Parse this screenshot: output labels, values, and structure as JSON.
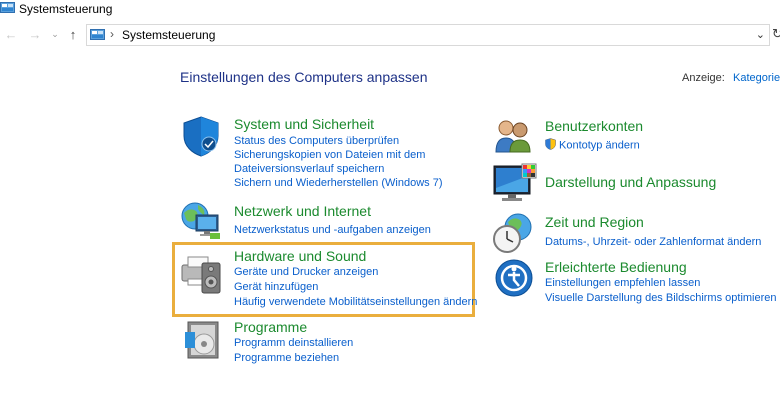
{
  "window": {
    "title": "Systemsteuerung"
  },
  "address": {
    "path": "Systemsteuerung"
  },
  "header": {
    "title": "Einstellungen des Computers anpassen",
    "view_label": "Anzeige:",
    "view_value": "Kategorie"
  },
  "categories": {
    "system": {
      "title": "System und Sicherheit",
      "links": [
        "Status des Computers überprüfen",
        "Sicherungskopien von Dateien mit dem",
        "Dateiversionsverlauf speichern",
        "Sichern und Wiederherstellen (Windows 7)"
      ]
    },
    "network": {
      "title": "Netzwerk und Internet",
      "links": [
        "Netzwerkstatus und -aufgaben anzeigen"
      ]
    },
    "hardware": {
      "title": "Hardware und Sound",
      "links": [
        "Geräte und Drucker anzeigen",
        "Gerät hinzufügen",
        "Häufig verwendete Mobilitätseinstellungen ändern"
      ]
    },
    "programs": {
      "title": "Programme",
      "links": [
        "Programm deinstallieren",
        "Programme beziehen"
      ]
    },
    "users": {
      "title": "Benutzerkonten",
      "links": [
        "Kontotyp ändern"
      ]
    },
    "appearance": {
      "title": "Darstellung und Anpassung",
      "links": []
    },
    "clock": {
      "title": "Zeit und Region",
      "links": [
        "Datums-, Uhrzeit- oder Zahlenformat ändern"
      ]
    },
    "access": {
      "title": "Erleichterte Bedienung",
      "links": [
        "Einstellungen empfehlen lassen",
        "Visuelle Darstellung des Bildschirms optimieren"
      ]
    }
  },
  "colors": {
    "heading_green": "#1b8a2e",
    "link_blue": "#0a5fcc",
    "title_blue": "#1e3287",
    "highlight": "#eaae3d"
  }
}
